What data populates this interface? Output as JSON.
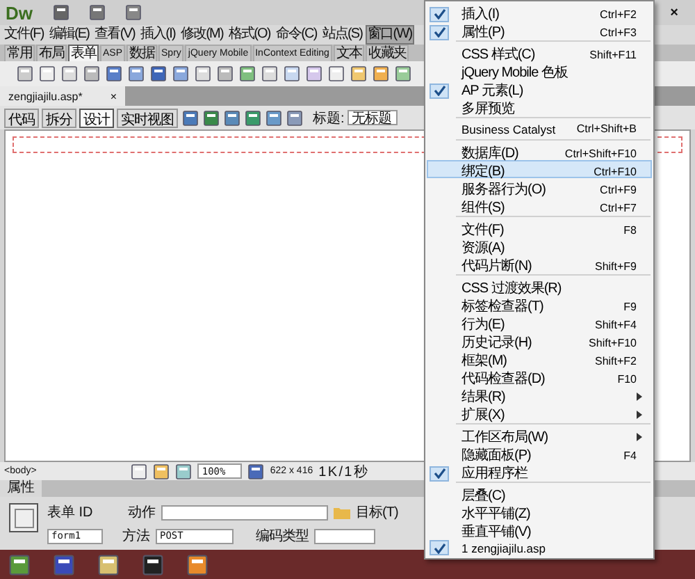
{
  "app": {
    "logo": "Dw",
    "close": "×"
  },
  "menu_bar": [
    {
      "label": "文件(F)",
      "selected": false
    },
    {
      "label": "编辑(E)",
      "selected": false
    },
    {
      "label": "查看(V)",
      "selected": false
    },
    {
      "label": "插入(I)",
      "selected": false
    },
    {
      "label": "修改(M)",
      "selected": false
    },
    {
      "label": "格式(O)",
      "selected": false
    },
    {
      "label": "命令(C)",
      "selected": false
    },
    {
      "label": "站点(S)",
      "selected": false
    },
    {
      "label": "窗口(W)",
      "selected": true
    }
  ],
  "insert_panel": {
    "tabs": [
      {
        "label": "常用",
        "selected": false
      },
      {
        "label": "布局",
        "selected": false
      },
      {
        "label": "表单",
        "selected": true
      },
      {
        "label": "ASP",
        "selected": false
      },
      {
        "label": "数据",
        "selected": false
      },
      {
        "label": "Spry",
        "selected": false
      },
      {
        "label": "jQuery Mobile",
        "selected": false
      },
      {
        "label": "InContext Editing",
        "selected": false
      },
      {
        "label": "文本",
        "selected": false
      },
      {
        "label": "收藏夹",
        "selected": false
      }
    ]
  },
  "document_tab": {
    "name": "zengjiajilu.asp*",
    "close": "×"
  },
  "view_buttons": [
    {
      "label": "代码",
      "selected": false
    },
    {
      "label": "拆分",
      "selected": false
    },
    {
      "label": "设计",
      "selected": true
    },
    {
      "label": "实时视图",
      "selected": false
    }
  ],
  "title_field": {
    "label": "标题:",
    "value": "无标题"
  },
  "status_bar": {
    "tag": "<body>",
    "zoom": "100%",
    "size": "622 x 416",
    "speed": "1 K / 1 秒"
  },
  "properties": {
    "tab": "属性",
    "form_id_label": "表单 ID",
    "form_id": "form1",
    "action_label": "动作",
    "target_label": "目标(T)",
    "method_label": "方法",
    "method": "POST",
    "enctype_label": "编码类型"
  },
  "window_menu": [
    {
      "kind": "item",
      "label": "插入(I)",
      "shortcut": "Ctrl+F2",
      "checked": true,
      "selected": false,
      "submenu": false
    },
    {
      "kind": "item",
      "label": "属性(P)",
      "shortcut": "Ctrl+F3",
      "checked": true,
      "selected": false,
      "submenu": false
    },
    {
      "kind": "separator"
    },
    {
      "kind": "item",
      "label": "CSS 样式(C)",
      "shortcut": "Shift+F11",
      "checked": false,
      "selected": false,
      "submenu": false
    },
    {
      "kind": "item",
      "label": "jQuery Mobile 色板",
      "checked": false,
      "selected": false,
      "submenu": false
    },
    {
      "kind": "item",
      "label": "AP 元素(L)",
      "checked": true,
      "selected": false,
      "submenu": false
    },
    {
      "kind": "item",
      "label": "多屏预览",
      "checked": false,
      "selected": false,
      "submenu": false
    },
    {
      "kind": "separator"
    },
    {
      "kind": "item",
      "label": "Business Catalyst",
      "shortcut": "Ctrl+Shift+B",
      "checked": false,
      "selected": false,
      "submenu": false
    },
    {
      "kind": "separator"
    },
    {
      "kind": "item",
      "label": "数据库(D)",
      "shortcut": "Ctrl+Shift+F10",
      "checked": false,
      "selected": false,
      "submenu": false
    },
    {
      "kind": "item",
      "label": "绑定(B)",
      "shortcut": "Ctrl+F10",
      "checked": false,
      "selected": true,
      "submenu": false
    },
    {
      "kind": "item",
      "label": "服务器行为(O)",
      "shortcut": "Ctrl+F9",
      "checked": false,
      "selected": false,
      "submenu": false
    },
    {
      "kind": "item",
      "label": "组件(S)",
      "shortcut": "Ctrl+F7",
      "checked": false,
      "selected": false,
      "submenu": false
    },
    {
      "kind": "separator"
    },
    {
      "kind": "item",
      "label": "文件(F)",
      "shortcut": "F8",
      "checked": false,
      "selected": false,
      "submenu": false
    },
    {
      "kind": "item",
      "label": "资源(A)",
      "checked": false,
      "selected": false,
      "submenu": false
    },
    {
      "kind": "item",
      "label": "代码片断(N)",
      "shortcut": "Shift+F9",
      "checked": false,
      "selected": false,
      "submenu": false
    },
    {
      "kind": "separator"
    },
    {
      "kind": "item",
      "label": "CSS 过渡效果(R)",
      "checked": false,
      "selected": false,
      "submenu": false
    },
    {
      "kind": "item",
      "label": "标签检查器(T)",
      "shortcut": "F9",
      "checked": false,
      "selected": false,
      "submenu": false
    },
    {
      "kind": "item",
      "label": "行为(E)",
      "shortcut": "Shift+F4",
      "checked": false,
      "selected": false,
      "submenu": false
    },
    {
      "kind": "item",
      "label": "历史记录(H)",
      "shortcut": "Shift+F10",
      "checked": false,
      "selected": false,
      "submenu": false
    },
    {
      "kind": "item",
      "label": "框架(M)",
      "shortcut": "Shift+F2",
      "checked": false,
      "selected": false,
      "submenu": false
    },
    {
      "kind": "item",
      "label": "代码检查器(D)",
      "shortcut": "F10",
      "checked": false,
      "selected": false,
      "submenu": false
    },
    {
      "kind": "item",
      "label": "结果(R)",
      "checked": false,
      "selected": false,
      "submenu": true
    },
    {
      "kind": "item",
      "label": "扩展(X)",
      "checked": false,
      "selected": false,
      "submenu": true
    },
    {
      "kind": "separator"
    },
    {
      "kind": "item",
      "label": "工作区布局(W)",
      "checked": false,
      "selected": false,
      "submenu": true
    },
    {
      "kind": "item",
      "label": "隐藏面板(P)",
      "shortcut": "F4",
      "checked": false,
      "selected": false,
      "submenu": false
    },
    {
      "kind": "item",
      "label": "应用程序栏",
      "checked": true,
      "selected": false,
      "submenu": false
    },
    {
      "kind": "separator"
    },
    {
      "kind": "item",
      "label": "层叠(C)",
      "checked": false,
      "selected": false,
      "submenu": false
    },
    {
      "kind": "item",
      "label": "水平平铺(Z)",
      "checked": false,
      "selected": false,
      "submenu": false
    },
    {
      "kind": "item",
      "label": "垂直平铺(V)",
      "checked": false,
      "selected": false,
      "submenu": false
    },
    {
      "kind": "item",
      "label": "1 zengjiajilu.asp",
      "checked": true,
      "selected": false,
      "submenu": false
    }
  ]
}
